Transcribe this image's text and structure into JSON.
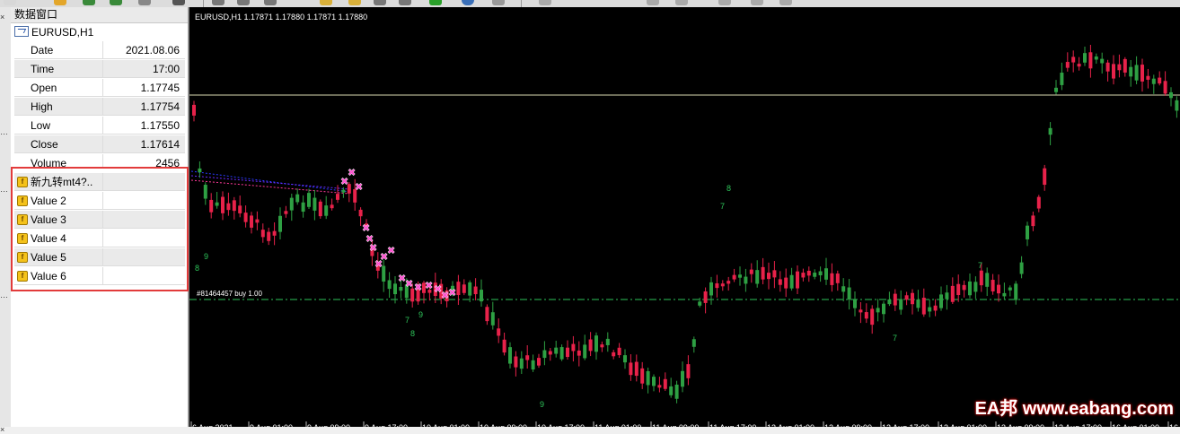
{
  "data_window": {
    "title": "数据窗口",
    "symbol": "EURUSD,H1",
    "rows": [
      {
        "label": "Date",
        "value": "2021.08.06"
      },
      {
        "label": "Time",
        "value": "17:00"
      },
      {
        "label": "Open",
        "value": "1.17745"
      },
      {
        "label": "High",
        "value": "1.17754"
      },
      {
        "label": "Low",
        "value": "1.17550"
      },
      {
        "label": "Close",
        "value": "1.17614"
      },
      {
        "label": "Volume",
        "value": "2456"
      }
    ],
    "indicator_rows": [
      {
        "label": "新九转mt4?..",
        "value": ""
      },
      {
        "label": "Value 2",
        "value": ""
      },
      {
        "label": "Value 3",
        "value": ""
      },
      {
        "label": "Value 4",
        "value": ""
      },
      {
        "label": "Value 5",
        "value": ""
      },
      {
        "label": "Value 6",
        "value": ""
      }
    ]
  },
  "chart": {
    "header": "EURUSD,H1  1.17871 1.17880 1.17871 1.17880",
    "order_label": "#81464457 buy 1.00",
    "x_labels": [
      "6 Aug 2021",
      "9 Aug 01:00",
      "9 Aug 09:00",
      "9 Aug 17:00",
      "10 Aug 01:00",
      "10 Aug 09:00",
      "10 Aug 17:00",
      "11 Aug 01:00",
      "11 Aug 09:00",
      "11 Aug 17:00",
      "12 Aug 01:00",
      "12 Aug 09:00",
      "12 Aug 17:00",
      "13 Aug 01:00",
      "13 Aug 09:00",
      "13 Aug 17:00",
      "16 Aug 01:00",
      "16 Aug 09:00"
    ],
    "count_labels": [
      {
        "text": "9"
      },
      {
        "text": "8"
      },
      {
        "text": "7"
      },
      {
        "text": "8"
      },
      {
        "text": "9"
      },
      {
        "text": "9"
      },
      {
        "text": "8"
      },
      {
        "text": "7"
      },
      {
        "text": "7"
      },
      {
        "text": "7"
      }
    ],
    "colors": {
      "bull": "#2ea043",
      "bear": "#e8224a",
      "count": "#2ec45a",
      "order_line": "#2ec45a",
      "level_line": "#d8d8b0",
      "marker": "#ff4fd0"
    }
  },
  "watermark": "EA邦 www.eabang.com"
}
